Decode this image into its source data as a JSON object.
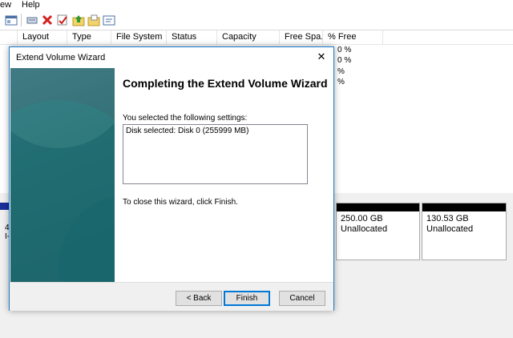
{
  "menubar": {
    "items": [
      "ew",
      "Help"
    ]
  },
  "toolbar": {
    "icons": [
      "view-icon",
      "properties-icon",
      "delete-icon",
      "check-icon",
      "folder-up-icon",
      "folder-open-icon",
      "console-icon"
    ]
  },
  "volume_list": {
    "columns": [
      "Layout",
      "Type",
      "File System",
      "Status",
      "Capacity",
      "Free Spa...",
      "% Free"
    ],
    "free_values": [
      "0 %",
      "0 %",
      "%",
      "%"
    ]
  },
  "disk_graph": {
    "left_fragment": [
      "4",
      "I-"
    ],
    "blocks": [
      {
        "size": "250.00 GB",
        "status": "Unallocated"
      },
      {
        "size": "130.53 GB",
        "status": "Unallocated"
      }
    ]
  },
  "wizard": {
    "title": "Extend Volume Wizard",
    "close_glyph": "✕",
    "heading": "Completing the Extend Volume Wizard",
    "settings_label": "You selected the following settings:",
    "settings_text": "Disk selected: Disk 0 (255999 MB)",
    "close_instruction": "To close this wizard, click Finish.",
    "buttons": {
      "back": "< Back",
      "finish": "Finish",
      "cancel": "Cancel"
    }
  },
  "colors": {
    "accent": "#0078d7",
    "side_panel": "#1d5c64",
    "partition_bar": "#000000",
    "primary_partition": "#1a2e9a"
  }
}
